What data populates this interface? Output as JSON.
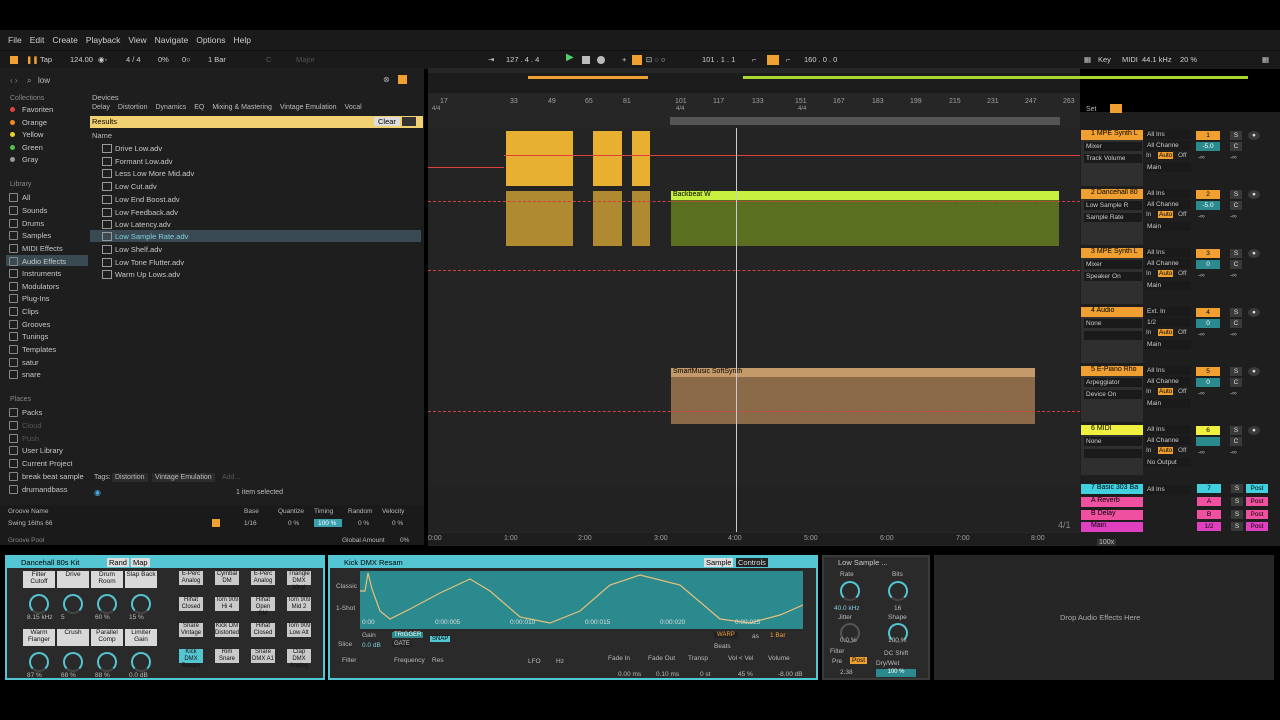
{
  "menu": [
    "File",
    "Edit",
    "Create",
    "Playback",
    "View",
    "Navigate",
    "Options",
    "Help"
  ],
  "transport": {
    "tap": "Tap",
    "tempo": "124.00",
    "signature": "4 / 4",
    "quantize": "1 Bar",
    "key_off": "C",
    "scale_off": "Major",
    "position": "127 . 4 . 4",
    "loop_start": "101 . 1 . 1",
    "loop_len": "160 . 0 . 0",
    "key": "Key",
    "midi": "MIDI",
    "rate": "44.1 kHz",
    "cpu": "20 %",
    "zoom_pct": "0%"
  },
  "browser": {
    "search": "low",
    "devices_label": "Devices",
    "categories": [
      "Delay",
      "Distortion",
      "Dynamics",
      "EQ",
      "Mixing & Mastering",
      "Vintage Emulation",
      "Vocal"
    ],
    "results_label": "Results",
    "clear": "Clear",
    "name_header": "Name",
    "collections_label": "Collections",
    "collections": [
      {
        "label": "Favoriten",
        "color": "#e0443a"
      },
      {
        "label": "Orange",
        "color": "#f08a24"
      },
      {
        "label": "Yellow",
        "color": "#e8d12a"
      },
      {
        "label": "Green",
        "color": "#4fc24a"
      },
      {
        "label": "Gray",
        "color": "#9a9a9a"
      }
    ],
    "library_label": "Library",
    "library": [
      "All",
      "Sounds",
      "Drums",
      "Samples",
      "MIDI Effects",
      "Audio Effects",
      "Instruments",
      "Modulators",
      "Plug-Ins",
      "Clips",
      "Grooves",
      "Tunings",
      "Templates",
      "satur",
      "snare"
    ],
    "places_label": "Places",
    "places": [
      "Packs",
      "Cloud",
      "Push",
      "User Library",
      "Current Project",
      "break beat sample",
      "drumandbass"
    ],
    "files": [
      "Drive Low.adv",
      "Formant Low.adv",
      "Less Low More Mid.adv",
      "Low Cut.adv",
      "Low End Boost.adv",
      "Low Feedback.adv",
      "Low Latency.adv",
      "Low Sample Rate.adv",
      "Low Shelf.adv",
      "Low Tone Flutter.adv",
      "Warm Up Lows.adv"
    ],
    "tags_label": "Tags:",
    "tags": [
      "Distortion",
      "Vintage Emulation"
    ],
    "add": "Add...",
    "status": "1 item selected"
  },
  "groove": {
    "headers": [
      "Groove Name",
      "Base",
      "Quantize",
      "Timing",
      "Random",
      "Velocity"
    ],
    "row": [
      "Swing 16ths 66",
      "1/16",
      "0 %",
      "100 %",
      "0 %",
      "0 %"
    ],
    "pool": "Groove Pool",
    "global_label": "Global Amount",
    "global_val": "0%"
  },
  "ruler": [
    "17",
    "33",
    "49",
    "65",
    "81",
    "101",
    "117",
    "133",
    "151",
    "167",
    "183",
    "199",
    "215",
    "231",
    "247",
    "263"
  ],
  "timeline": [
    "0:00",
    "1:00",
    "2:00",
    "3:00",
    "4:00",
    "5:00",
    "6:00",
    "7:00",
    "8:00"
  ],
  "sig_markers": [
    "4/4",
    "4/4",
    "4/4"
  ],
  "clips": {
    "backbeat": "Backbeat W",
    "softsynth": "SmartMusic SoftSynth",
    "marker": "4/1"
  },
  "tracks": [
    {
      "name": "1 MPE Synth L",
      "num": "1",
      "color": "#f0a030",
      "in": "All Ins",
      "ch": "All Channe",
      "a": "Mixer",
      "b": "Track Volume",
      "vol": "-5.0",
      "out": "Main"
    },
    {
      "name": "2 Dancehall 80",
      "num": "2",
      "color": "#f0a030",
      "in": "All Ins",
      "ch": "All Channe",
      "a": "Low Sample R",
      "b": "Sample Rate",
      "vol": "-5.0",
      "out": "Main"
    },
    {
      "name": "3 MPE Synth L",
      "num": "3",
      "color": "#f0a030",
      "in": "All Ins",
      "ch": "All Channe",
      "a": "Mixer",
      "b": "Speaker On",
      "vol": "0",
      "out": "Main"
    },
    {
      "name": "4 Audio",
      "num": "4",
      "color": "#f0a030",
      "in": "Ext. In",
      "ch": "1/2",
      "a": "None",
      "b": "",
      "vol": "0",
      "out": "Main"
    },
    {
      "name": "5 E-Piano Rho",
      "num": "5",
      "color": "#f0a030",
      "in": "All Ins",
      "ch": "All Channe",
      "a": "Arpeggiator",
      "b": "Device On",
      "vol": "0",
      "out": "Main"
    },
    {
      "name": "6 MIDI",
      "num": "6",
      "color": "#f0f040",
      "in": "All Ins",
      "ch": "All Channe",
      "a": "None",
      "b": "",
      "vol": "",
      "out": "No Output"
    }
  ],
  "returns": [
    {
      "name": "7 Basic 303 Ba",
      "num": "7",
      "color": "#40d0e0"
    },
    {
      "name": "A Reverb",
      "num": "A",
      "color": "#f050a0"
    },
    {
      "name": "B Delay",
      "num": "B",
      "color": "#f050a0"
    },
    {
      "name": "Main",
      "num": "1/2",
      "color": "#e040c0"
    }
  ],
  "mixer_labels": {
    "in": "In",
    "auto": "Auto",
    "off": "Off",
    "set": "Set",
    "neg_inf": "-∞",
    "zoom": "100x",
    "post": "Post",
    "s": "S",
    "c": "C"
  },
  "drumrack": {
    "title": "Dancehall 80s Kit",
    "rand": "Rand",
    "map": "Map",
    "macros": [
      {
        "l": "Filter Cutoff",
        "v": "8.15 kHz"
      },
      {
        "l": "Drive",
        "v": "5"
      },
      {
        "l": "Drum Room",
        "v": "60 %"
      },
      {
        "l": "Slap Back",
        "v": "15 %"
      },
      {
        "l": "Warm Flanger",
        "v": "87 %"
      },
      {
        "l": "Crush",
        "v": "68 %"
      },
      {
        "l": "Parallel Comp",
        "v": "88 %"
      },
      {
        "l": "Limiter Gain",
        "v": "0.0 dB"
      }
    ],
    "pads": [
      "E-Perc Analog",
      "Cymbal DM",
      "E-Perc Analog",
      "Triangle DMX Vinyl",
      "Hihat Closed",
      "Tom 909 Hi 4",
      "Hihat Open DM",
      "Tom 909 Mid 2",
      "Snare Vintage",
      "Kick DM Distorted",
      "Hihat Closed",
      "Tom 909 Low Alt",
      "Kick DMX Resam",
      "Rim Snare",
      "Snare DMX A1",
      "Clap DMX Analog"
    ]
  },
  "sampler": {
    "title": "Kick DMX Resam",
    "tab_sample": "Sample",
    "tab_controls": "Controls",
    "mode": "Classic",
    "oneshot": "1-Shot",
    "slice": "Slice",
    "gain_label": "Gain",
    "gain": "0.0 dB",
    "trigger": "TRIGGER",
    "gate": "GATE",
    "snap": "SNAP",
    "warp": "WARP",
    "as": "as",
    "bars": "1 Bar",
    "beats": "Beats",
    "times": [
      "0:00",
      "0:00:005",
      "0:00:010",
      "0:00:015",
      "0:00:020",
      "0:00:025"
    ],
    "filter": "Filter",
    "freq": "Frequency",
    "res": "Res",
    "lfo": "LFO",
    "hz": "Hz",
    "fadein_l": "Fade In",
    "fadein": "0.00 ms",
    "fadeout_l": "Fade Out",
    "fadeout": "0.10 ms",
    "transp_l": "Transp",
    "transp": "0 st",
    "vel_l": "Vol < Vel",
    "vel": "45 %",
    "vol_l": "Volume",
    "vol": "-8.00 dB"
  },
  "redux": {
    "title": "Low Sample ...",
    "rate_l": "Rate",
    "rate": "40.0 kHz",
    "bits_l": "Bits",
    "bits": "16",
    "jitter_l": "Jitter",
    "jitter": "0.0 %",
    "shape_l": "Shape",
    "shape": "100 %",
    "filter": "Filter",
    "pre": "Pre",
    "post": "Post",
    "fval": "2.38",
    "dc": "DC Shift",
    "dw_l": "Dry/Wet",
    "dw": "100 %"
  },
  "drop": "Drop Audio Effects Here"
}
